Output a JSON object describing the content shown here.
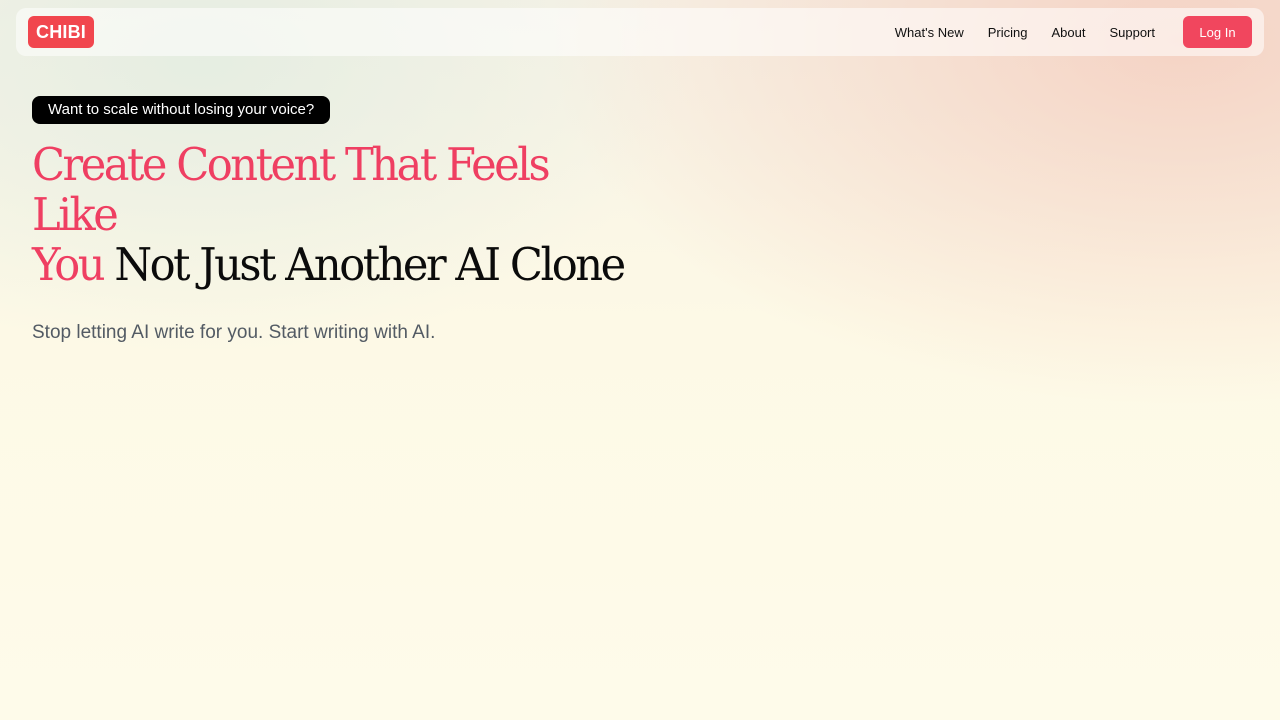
{
  "nav": {
    "logo": "CHIBI",
    "links": [
      "What's New",
      "Pricing",
      "About",
      "Support"
    ],
    "login_label": "Log In"
  },
  "hero": {
    "pill": "Want to scale without losing your voice?",
    "headline_accent_1": "Create Content That Feels Like",
    "headline_accent_2": "You",
    "headline_rest": "Not Just Another AI Clone",
    "subtitle": "Stop letting AI write for you. Start writing with AI."
  },
  "colors": {
    "brand": "#f1464e",
    "accent": "#ef3f62",
    "text_dark": "#0b0b0b",
    "subtitle": "#535b64"
  }
}
